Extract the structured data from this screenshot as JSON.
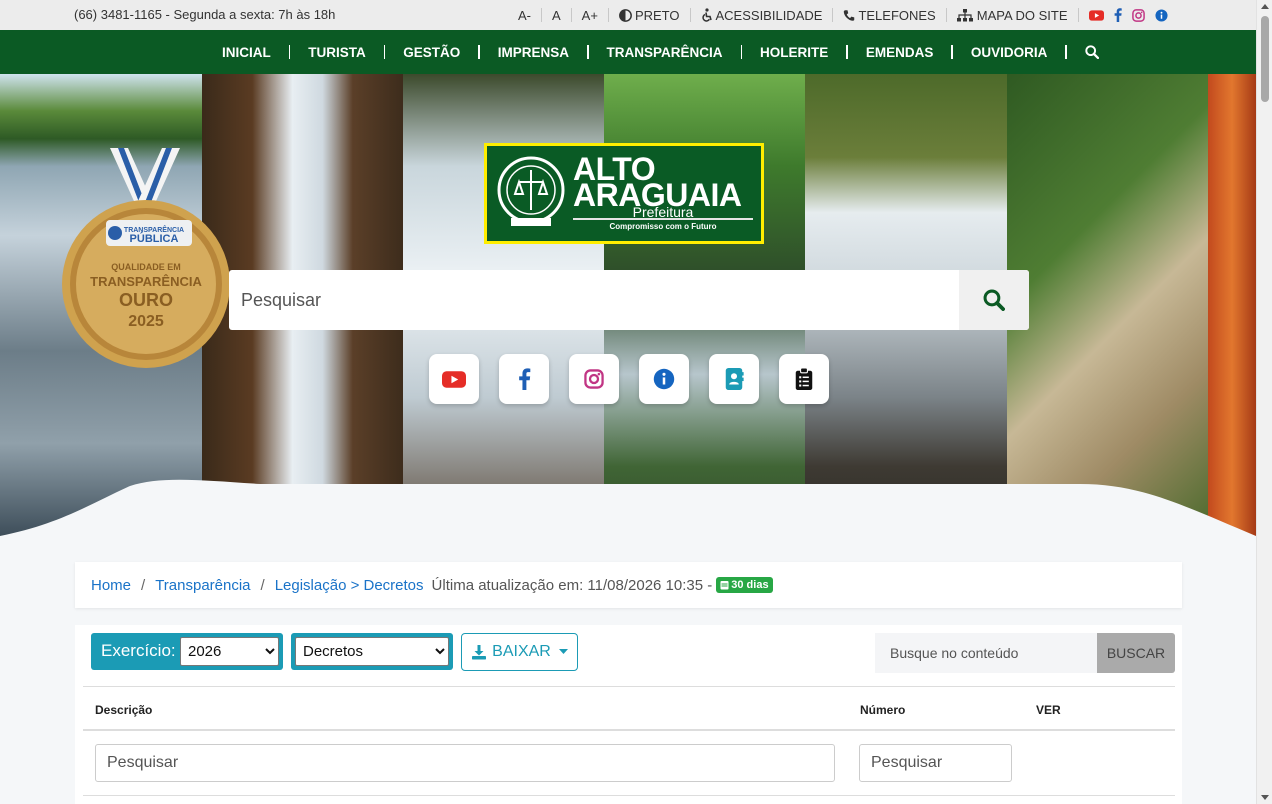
{
  "topbar": {
    "contact": "(66) 3481-1165 - Segunda a sexta: 7h às 18h",
    "font_small": "A-",
    "font_normal": "A",
    "font_large": "A+",
    "contrast": "PRETO",
    "accessibility": "ACESSIBILIDADE",
    "phones": "TELEFONES",
    "sitemap": "MAPA DO SITE"
  },
  "nav": {
    "items": [
      {
        "label": "INICIAL"
      },
      {
        "label": "TURISTA"
      },
      {
        "label": "GESTÃO"
      },
      {
        "label": "IMPRENSA"
      },
      {
        "label": "TRANSPARÊNCIA"
      },
      {
        "label": "HOLERITE"
      },
      {
        "label": "EMENDAS"
      },
      {
        "label": "OUVIDORIA"
      }
    ]
  },
  "medal": {
    "line1": "TRANSPARÊNCIA",
    "line2": "PÚBLICA",
    "line3": "QUALIDADE EM",
    "line4": "TRANSPARÊNCIA",
    "line5": "OURO",
    "line6": "2025"
  },
  "logo": {
    "name1": "ALTO",
    "name2": "ARAGUAIA",
    "subtitle": "Prefeitura",
    "slogan": "Compromisso com o Futuro"
  },
  "hero_search": {
    "placeholder": "Pesquisar"
  },
  "social_icons": [
    "youtube-icon",
    "facebook-icon",
    "instagram-icon",
    "info-icon",
    "contacts-icon",
    "clipboard-icon"
  ],
  "breadcrumb": {
    "home": "Home",
    "section": "Transparência",
    "page": "Legislação > Decretos",
    "updated": "Última atualização em: 11/08/2026 10:35 -",
    "badge": "30 dias"
  },
  "filters": {
    "year_label": "Exercício:",
    "year_value": "2026",
    "category_value": "Decretos",
    "download_label": "BAIXAR",
    "content_search_placeholder": "Busque no conteúdo",
    "search_button": "BUSCAR"
  },
  "table": {
    "headers": {
      "description": "Descrição",
      "number": "Número",
      "view": "VER"
    },
    "filter_description_placeholder": "Pesquisar",
    "filter_number_placeholder": "Pesquisar"
  },
  "colors": {
    "nav_green": "#0b5a24",
    "logo_yellow": "#ffee00",
    "teal": "#1b9bb5",
    "link_blue": "#1a73c8",
    "badge_green": "#28a745"
  }
}
